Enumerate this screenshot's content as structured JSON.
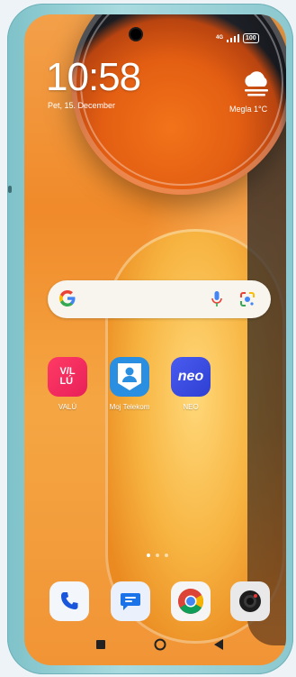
{
  "status_bar": {
    "network": "4G",
    "battery": "100"
  },
  "lock": {
    "time": "10:58",
    "date": "Pet, 15. December"
  },
  "weather": {
    "text": "Megla  1°C",
    "icon": "cloud-fog-icon"
  },
  "search": {
    "icon": "google-icon"
  },
  "apps": [
    {
      "label": "VALÚ",
      "tile_text_top": "V/L",
      "tile_text_bottom": "LÚ",
      "color": "#f0306a"
    },
    {
      "label": "Moj Telekom",
      "color": "#2a8fe0"
    },
    {
      "label": "NEO",
      "tile_text": "neo",
      "color": "#3b4fe0"
    }
  ],
  "dock": [
    {
      "name": "phone",
      "icon": "phone-icon"
    },
    {
      "name": "messages",
      "icon": "message-icon"
    },
    {
      "name": "chrome",
      "icon": "chrome-icon"
    },
    {
      "name": "camera",
      "icon": "camera-icon"
    }
  ],
  "page_indicator": {
    "pages": 3,
    "current": 1
  },
  "nav": {
    "back": "back-icon",
    "home": "home-icon",
    "recents": "recents-icon"
  }
}
